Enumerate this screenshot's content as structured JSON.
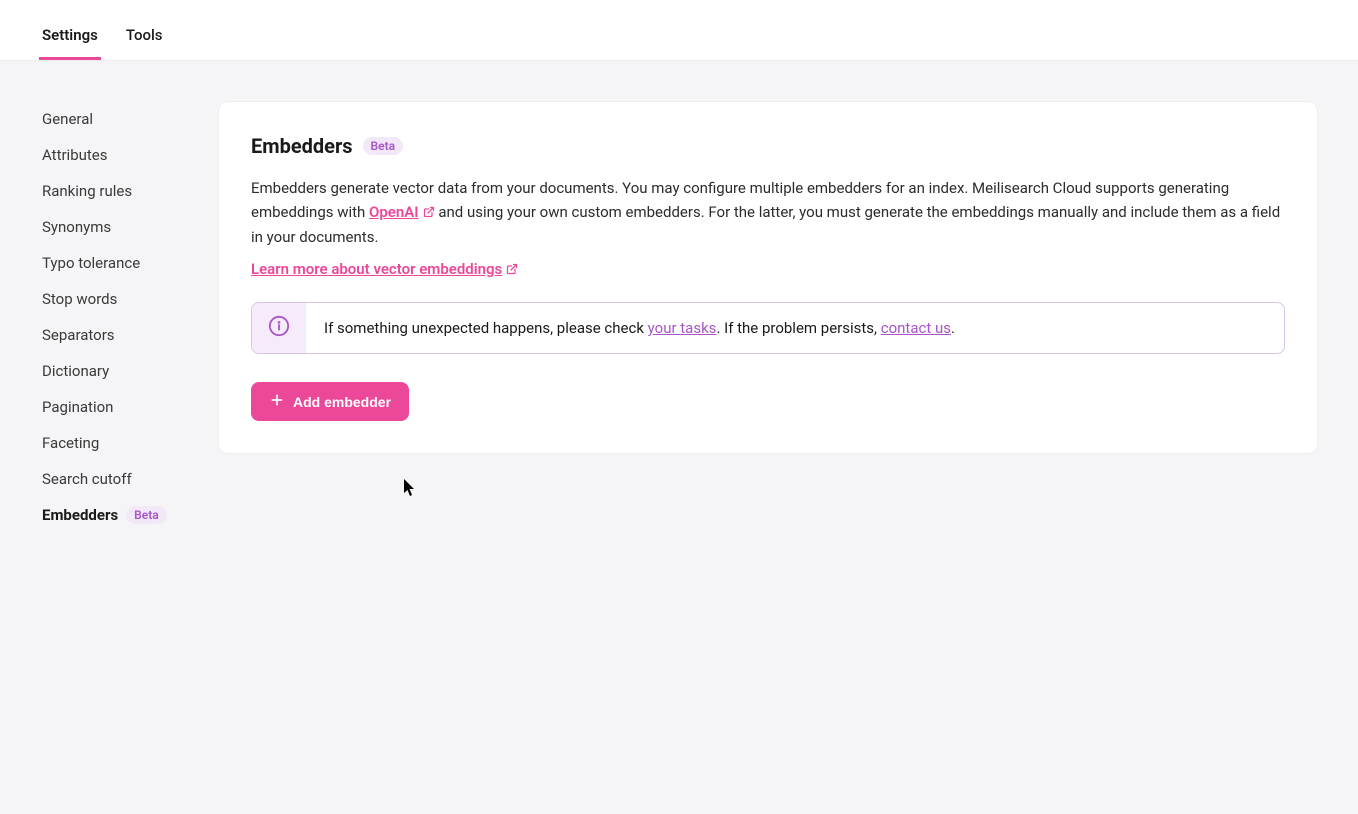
{
  "tabs": [
    {
      "label": "Settings",
      "active": true
    },
    {
      "label": "Tools",
      "active": false
    }
  ],
  "sidebar": {
    "items": [
      {
        "label": "General"
      },
      {
        "label": "Attributes"
      },
      {
        "label": "Ranking rules"
      },
      {
        "label": "Synonyms"
      },
      {
        "label": "Typo tolerance"
      },
      {
        "label": "Stop words"
      },
      {
        "label": "Separators"
      },
      {
        "label": "Dictionary"
      },
      {
        "label": "Pagination"
      },
      {
        "label": "Faceting"
      },
      {
        "label": "Search cutoff"
      },
      {
        "label": "Embedders",
        "badge": "Beta",
        "active": true
      }
    ]
  },
  "page": {
    "title": "Embedders",
    "badge": "Beta",
    "desc_part1": "Embedders generate vector data from your documents. You may configure multiple embedders for an index. Meilisearch Cloud supports generating embeddings with ",
    "openai_link": "OpenAI",
    "desc_part2": " and using your own custom embedders. For the latter, you must generate the embeddings manually and include them as a field in your documents.",
    "learn_more": "Learn more about vector embeddings",
    "alert": {
      "prefix": "If something unexpected happens, please check ",
      "your_tasks": "your tasks",
      "middle": ". If the problem persists, ",
      "contact_us": "contact us",
      "suffix": "."
    },
    "add_button": "Add embedder"
  }
}
